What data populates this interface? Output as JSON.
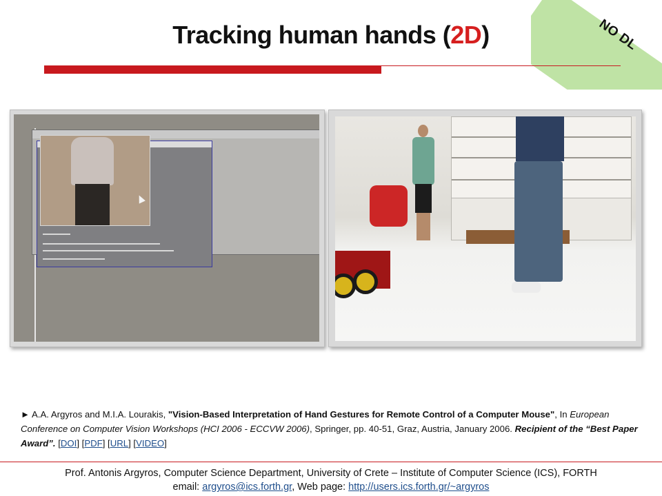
{
  "slide": {
    "title_prefix": "Tracking human hands (",
    "title_accent": "2D",
    "title_suffix": ")",
    "badge": "NO DL",
    "accent_color": "#c8191e",
    "badge_color": "#bfe3a5"
  },
  "left_video": {
    "window_title": "On line 3D Tracking of Skin color",
    "console_lines": [
      "Press enter to start....",
      "*** REAL-TIME 2D TRACKING OF MULTIPLE SKIN-COLORED REGIONS ***",
      "Frame = ; Mouse is DE-ACTIVATED"
    ]
  },
  "citation": {
    "bullet": "►",
    "authors": "A.A. Argyros and M.I.A. Lourakis, ",
    "paper_title": "\"Vision-Based Interpretation of Hand Gestures for Remote Control of a Computer Mouse\"",
    "in": ", In ",
    "venue": "European Conference on Computer Vision Workshops (HCI 2006 - ECCVW 2006)",
    "details": ", Springer, pp. 40-51, Graz, Austria, January 2006. ",
    "award": "Recipient of the “Best Paper Award”.",
    "links": [
      "DOI",
      "PDF",
      "URL",
      "VIDEO"
    ]
  },
  "footer": {
    "line1": "Prof. Antonis Argyros, Computer Science Department, University of Crete – Institute of Computer Science (ICS), FORTH",
    "email_label": "email: ",
    "email": "argyros@ics.forth.gr",
    "web_label": ",  Web page:  ",
    "web": "http://users.ics.forth.gr/~argyros"
  }
}
